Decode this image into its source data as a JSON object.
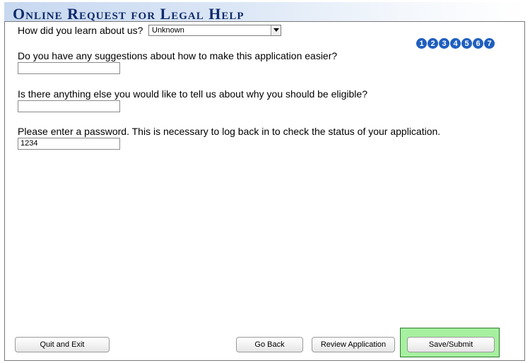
{
  "header": {
    "title": "Online Request for Legal Help"
  },
  "form": {
    "referral_label": "How did you learn about us?",
    "referral_value": "Unknown",
    "suggestions_label": "Do you have any suggestions about how to make this application easier?",
    "suggestions_value": "",
    "eligibility_label": "Is there anything else you would like to tell us about why you should be eligible?",
    "eligibility_value": "",
    "password_label": "Please enter a password. This is necessary to log back in to check the status of your application.",
    "password_value": "1234"
  },
  "steps": [
    "1",
    "2",
    "3",
    "4",
    "5",
    "6",
    "7"
  ],
  "buttons": {
    "quit": "Quit and Exit",
    "back": "Go Back",
    "review": "Review Application",
    "submit": "Save/Submit"
  },
  "colors": {
    "title": "#0f2a6b",
    "step_badge": "#1f5fbf",
    "submit_highlight": "#a6f0a0"
  }
}
